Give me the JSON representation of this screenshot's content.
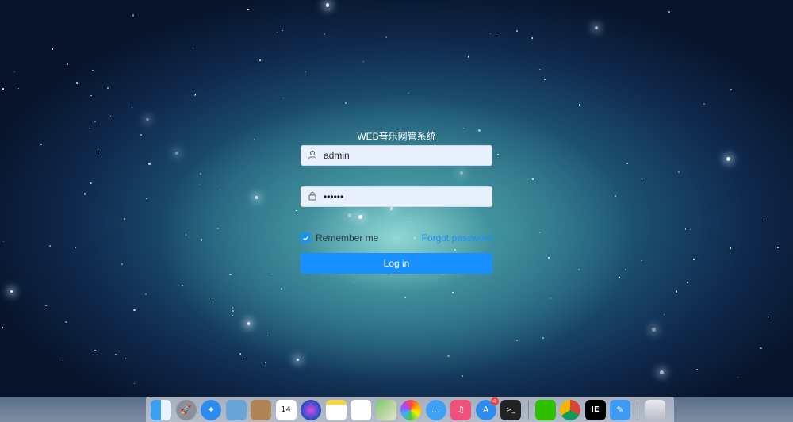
{
  "login": {
    "title": "WEB音乐网管系统",
    "username_value": "admin",
    "password_value": "••••••",
    "remember_label": "Remember me",
    "remember_checked": true,
    "forgot_label": "Forgot password",
    "login_label": "Log in"
  },
  "colors": {
    "primary": "#1890ff",
    "input_bg": "#e8f0fe"
  },
  "dock": {
    "apps": [
      {
        "name": "finder-icon"
      },
      {
        "name": "launchpad-icon"
      },
      {
        "name": "safari-icon"
      },
      {
        "name": "preview-icon"
      },
      {
        "name": "contacts-icon"
      },
      {
        "name": "calendar-icon",
        "label": "14"
      },
      {
        "name": "siri-icon"
      },
      {
        "name": "notes-icon"
      },
      {
        "name": "reminders-icon"
      },
      {
        "name": "maps-icon"
      },
      {
        "name": "photos-icon"
      },
      {
        "name": "messages-icon"
      },
      {
        "name": "music-icon"
      },
      {
        "name": "app-store-icon",
        "badge": "4"
      },
      {
        "name": "terminal-icon",
        "label": ">_"
      },
      {
        "name": "wechat-icon"
      },
      {
        "name": "chrome-icon"
      },
      {
        "name": "intellij-icon",
        "label": "IE"
      },
      {
        "name": "draw-icon"
      },
      {
        "name": "trash-icon"
      }
    ]
  }
}
